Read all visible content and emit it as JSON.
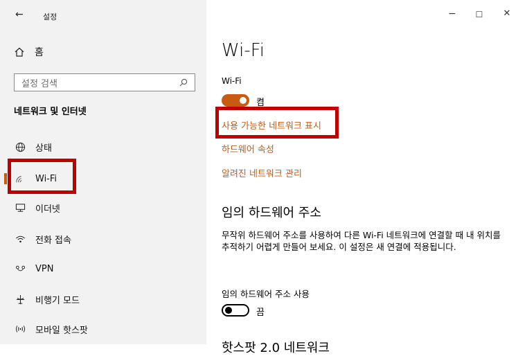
{
  "window": {
    "back_glyph": "←",
    "title": "설정",
    "minimize": "−",
    "maximize": "☐",
    "close": "✕"
  },
  "sidebar": {
    "home_label": "홈",
    "search_placeholder": "설정 검색",
    "section_title": "네트워크 및 인터넷",
    "items": [
      {
        "label": "상태",
        "icon": "globe-icon"
      },
      {
        "label": "Wi-Fi",
        "icon": "wifi-icon",
        "active": true
      },
      {
        "label": "이더넷",
        "icon": "ethernet-icon"
      },
      {
        "label": "전화 접속",
        "icon": "dialup-icon"
      },
      {
        "label": "VPN",
        "icon": "vpn-icon"
      },
      {
        "label": "비행기 모드",
        "icon": "airplane-icon"
      },
      {
        "label": "모바일 핫스팟",
        "icon": "hotspot-icon"
      }
    ]
  },
  "main": {
    "title": "Wi-Fi",
    "wifi_label": "Wi-Fi",
    "wifi_state": "켬",
    "links": [
      "사용 가능한 네트워크 표시",
      "하드웨어 속성",
      "알려진 네트워크 관리"
    ],
    "random_hw_heading": "임의 하드웨어 주소",
    "random_hw_desc": "무작위 하드웨어 주소를 사용하여 다른 Wi-Fi 네트워크에 연결할 때 내 위치를 추적하기 어렵게 만들어 보세요. 이 설정은 새 연결에 적용됩니다.",
    "random_hw_toggle_label": "임의 하드웨어 주소 사용",
    "random_hw_state": "끔",
    "next_heading": "핫스팟 2.0 네트워크"
  },
  "colors": {
    "accent": "#c75b12",
    "highlight_box": "#c00000",
    "sidebar_bg": "#f2f2f2"
  }
}
